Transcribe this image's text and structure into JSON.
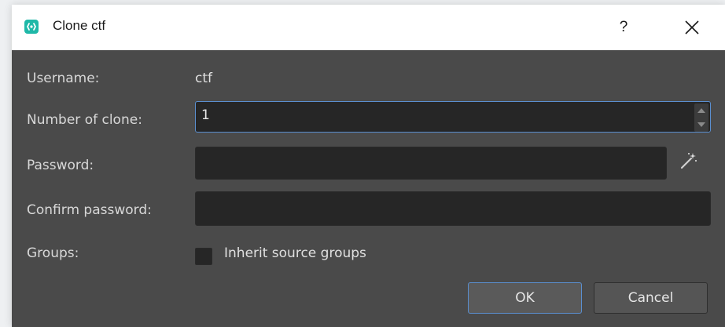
{
  "window": {
    "title": "Clone ctf",
    "help_label": "?",
    "app_icon": "app-logo-icon",
    "close_icon": "close-icon"
  },
  "form": {
    "username_label": "Username:",
    "username_value": "ctf",
    "number_label": "Number of clone:",
    "number_value": "1",
    "password_label": "Password:",
    "password_value": "",
    "generate_icon": "magic-wand-icon",
    "confirm_label": "Confirm password:",
    "confirm_value": "",
    "groups_label": "Groups:",
    "inherit_label": "Inherit source groups",
    "inherit_checked": false
  },
  "buttons": {
    "ok_label": "OK",
    "cancel_label": "Cancel"
  },
  "colors": {
    "dialog_bg": "#4a4a4a",
    "field_bg": "#262626",
    "focus_border": "#5a8fd0",
    "app_icon": "#1fb8a8"
  }
}
